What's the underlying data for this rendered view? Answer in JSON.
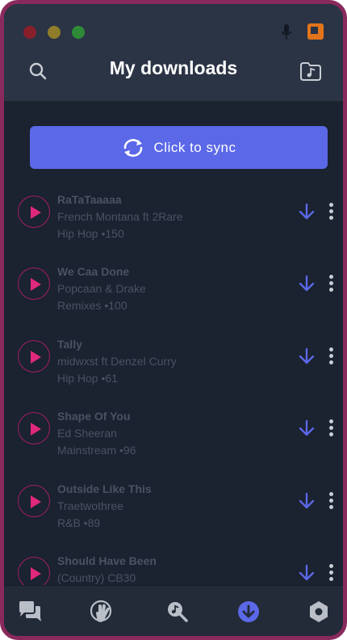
{
  "header": {
    "title": "My downloads"
  },
  "sync": {
    "label": "Click to sync"
  },
  "tracks": [
    {
      "title": "RaTaTaaaaa",
      "artist": "French Montana ft 2Rare",
      "meta": "Hip Hop •150"
    },
    {
      "title": "We Caa Done",
      "artist": "Popcaan & Drake",
      "meta": "Remixes •100"
    },
    {
      "title": "Tally",
      "artist": "midwxst ft Denzel Curry",
      "meta": "Hip Hop •61"
    },
    {
      "title": "Shape Of You",
      "artist": "Ed Sheeran",
      "meta": "Mainstream •96"
    },
    {
      "title": "Outside Like This",
      "artist": "Traetwothree",
      "meta": "R&B •89"
    },
    {
      "title": "Should Have Been",
      "artist": "(Country) CB30",
      "meta": ""
    }
  ],
  "nav": [
    {
      "icon": "chat-icon",
      "active": false
    },
    {
      "icon": "wave-hand-icon",
      "active": false
    },
    {
      "icon": "music-search-icon",
      "active": false
    },
    {
      "icon": "download-icon",
      "active": true
    },
    {
      "icon": "settings-icon",
      "active": false
    }
  ],
  "colors": {
    "accent": "#5b68e8",
    "play": "#e0287d",
    "background": "#1b2230",
    "header": "#2b3445"
  }
}
